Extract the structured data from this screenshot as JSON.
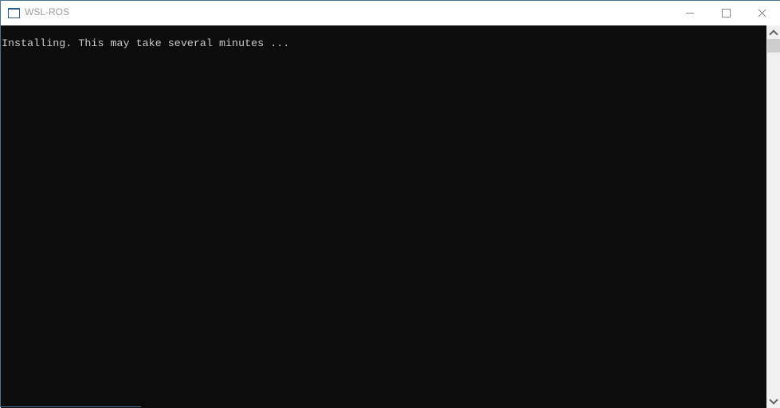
{
  "window": {
    "title": "WSL-ROS",
    "icon": "console-window-icon",
    "controls": {
      "minimize": "minimize-icon",
      "maximize": "maximize-icon",
      "close": "close-icon"
    }
  },
  "console": {
    "lines": [
      "Installing. This may take several minutes ..."
    ],
    "colors": {
      "background": "#0c0c0c",
      "foreground": "#cccccc"
    }
  },
  "scrollbar": {
    "up_icon": "chevron-up-icon",
    "down_icon": "chevron-down-icon",
    "position": 0
  }
}
